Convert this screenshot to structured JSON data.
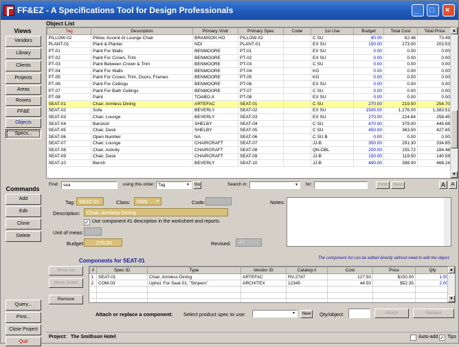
{
  "window": {
    "title": "FF&EZ - A Specifications Tool for Design Professionals"
  },
  "sidebar": {
    "views_heading": "Views",
    "views": [
      "Vendors",
      "Library",
      "Clients",
      "Projects",
      "Areas",
      "Rooms",
      "FF&E",
      "Objects",
      "Specs..."
    ],
    "commands_heading": "Commands",
    "commands": [
      "Add",
      "Edit",
      "Clone",
      "Delete"
    ],
    "bottom": [
      "Query...",
      "Print...",
      "Close Project",
      "Quit"
    ]
  },
  "object_list": {
    "label": "Object List",
    "columns": [
      "Tag",
      "Description",
      "Primary Vndr",
      "Primary Spec",
      "Code",
      "1st Use",
      "Budget",
      "Total Cost",
      "Total Price"
    ],
    "rows": [
      [
        "PILLOW-02",
        "Pillow, Accent At Lounge Chair",
        "BRAMSON HO",
        "PILLOW-02",
        "",
        "C SU",
        "80.00",
        "62.46",
        "73.49"
      ],
      [
        "PLANT-01",
        "Plant & Planter",
        "NDI",
        "PLANT-01",
        "",
        "EX SU",
        "150.00",
        "173.00",
        "203.53"
      ],
      [
        "PT-01",
        "Paint For Walls",
        "BENMOORE",
        "PT-01",
        "",
        "EX SU",
        "0.00",
        "0.00",
        "0.00"
      ],
      [
        "PT-02",
        "Paint For Crown, Trim",
        "BENMOORE",
        "PT-02",
        "",
        "EX SU",
        "0.00",
        "0.00",
        "0.00"
      ],
      [
        "PT-03",
        "Paint Between Crown & Trim",
        "BENMOORE",
        "PT-03",
        "",
        "C SU",
        "0.00",
        "0.00",
        "0.00"
      ],
      [
        "PT-04",
        "Paint For Walls",
        "BENMOORE",
        "PT-04",
        "",
        "KG",
        "0.00",
        "0.00",
        "0.00"
      ],
      [
        "PT-05",
        "Paint For Crown, Trim, Doors, Frames",
        "BENMOORE",
        "PT-05",
        "",
        "KG",
        "0.00",
        "0.00",
        "0.00"
      ],
      [
        "PT-06",
        "Paint For Ceilings",
        "BENMOORE",
        "PT-06",
        "",
        "EX SU",
        "0.00",
        "0.00",
        "0.00"
      ],
      [
        "PT-07",
        "Paint For Bath Ceilings",
        "BENMOORE",
        "PT-07",
        "",
        "C SU",
        "0.00",
        "0.00",
        "0.00"
      ],
      [
        "PT-08",
        "Paint",
        "TOABO-X",
        "PT-08",
        "",
        "EX SU",
        "0.00",
        "0.00",
        "0.00"
      ],
      [
        "SEAT-01",
        "Chair, Armless Dining",
        "ARTEFAC",
        "SEAT-01",
        "",
        "C SU",
        "270.00",
        "219.50",
        "254.70"
      ],
      [
        "SEAT-02",
        "Sofa",
        "BEVERLY",
        "SEAT-02",
        "",
        "EX SU",
        "1500.00",
        "1,176.00",
        "1,383.51"
      ],
      [
        "SEAT-03",
        "Chair, Lounge",
        "BEVERLY",
        "SEAT-03",
        "",
        "EX SU",
        "270.00",
        "224.84",
        "258.45"
      ],
      [
        "SEAT-04",
        "Barstool",
        "SHELBY",
        "SEAT-04",
        "",
        "C SU",
        "470.00",
        "379.00",
        "445.88"
      ],
      [
        "SEAT-05",
        "Chair, Desk",
        "SHELBY",
        "SEAT-05",
        "",
        "C SU",
        "450.00",
        "363.50",
        "427.65"
      ],
      [
        "SEAT-06",
        "Open Number",
        "NA",
        "SEAT-06",
        "",
        "C SU B",
        "0.00",
        "0.00",
        "0.00"
      ],
      [
        "SEAT-07",
        "Chair, Lounge",
        "CHAIRCRAFT",
        "SEAT-07",
        "",
        "JJ-B",
        "350.00",
        "291.30",
        "334.85"
      ],
      [
        "SEAT-08",
        "Chair, Activity",
        "CHAIRCRAFT",
        "SEAT-08",
        "",
        "QN-DBL",
        "200.00",
        "155.72",
        "184.48"
      ],
      [
        "SEAT-09",
        "Chair, Desk",
        "CHAIRCRAFT",
        "SEAT-09",
        "",
        "JJ-B",
        "150.00",
        "119.50",
        "140.59"
      ],
      [
        "SEAT-10",
        "Bench",
        "BEVERLY",
        "SEAT-10",
        "",
        "JJ-B",
        "490.00",
        "398.00",
        "468.24"
      ]
    ],
    "selected_index": 10
  },
  "findbar": {
    "find_label": "Find:",
    "find_value": "sea",
    "order_label": "using this order:",
    "order_value": "Tag",
    "go": "Go",
    "search_in_label": "Search in:",
    "search_in_value": "",
    "for_label": "for:",
    "for_value": "",
    "find_btn": "Find",
    "next_btn": "Next",
    "font_big": "A",
    "font_small": "A"
  },
  "detail": {
    "tag_label": "Tag:",
    "tag_value": "SEAT-01",
    "class_label": "Class:",
    "class_value": "FRN",
    "code_label": "Code:",
    "notes_label": "Notes:",
    "desc_label": "Description:",
    "desc_value": "Chair, Armless Dining",
    "use_component_text": "Use component #1 description in the worksheet and reports.",
    "unit_label": "Unit of meas:",
    "budget_label": "Budget:",
    "budget_value": "270.00",
    "revised_label": "Revised:",
    "revised_value": "/ /"
  },
  "components": {
    "title": "Components for SEAT-01",
    "note": "The component list can be edited directly without need to edit the object.",
    "move_up": "Move Up",
    "move_down": "Move Down",
    "remove": "Remove",
    "columns": [
      "#",
      "Spec ID",
      "Type",
      "Vendor ID",
      "Catalog #",
      "Cost",
      "Price",
      "Qty"
    ],
    "rows": [
      [
        "1",
        "SEAT-01",
        "Chair, Armless Dining",
        "ARTEFAC",
        "RV-2747",
        "127.50",
        "$150.00",
        "1.00"
      ],
      [
        "2",
        "COM-03",
        "Uphol. For Seat-01, \"Stripers\"",
        "ARCHITEX",
        "12345",
        "44.50",
        "$52.35",
        "2.00"
      ]
    ],
    "attach_label": "Attach or replace a component:",
    "select_label": "Select product spec to use:",
    "new_btn": "New",
    "qty_label": "Qty/object:",
    "attach_btn": "Attach",
    "replace_btn": "Replace"
  },
  "footer": {
    "project_label": "Project:",
    "project_value": "The Smithson Hotel",
    "auto_add": "Auto-add",
    "tips": "Tips"
  }
}
